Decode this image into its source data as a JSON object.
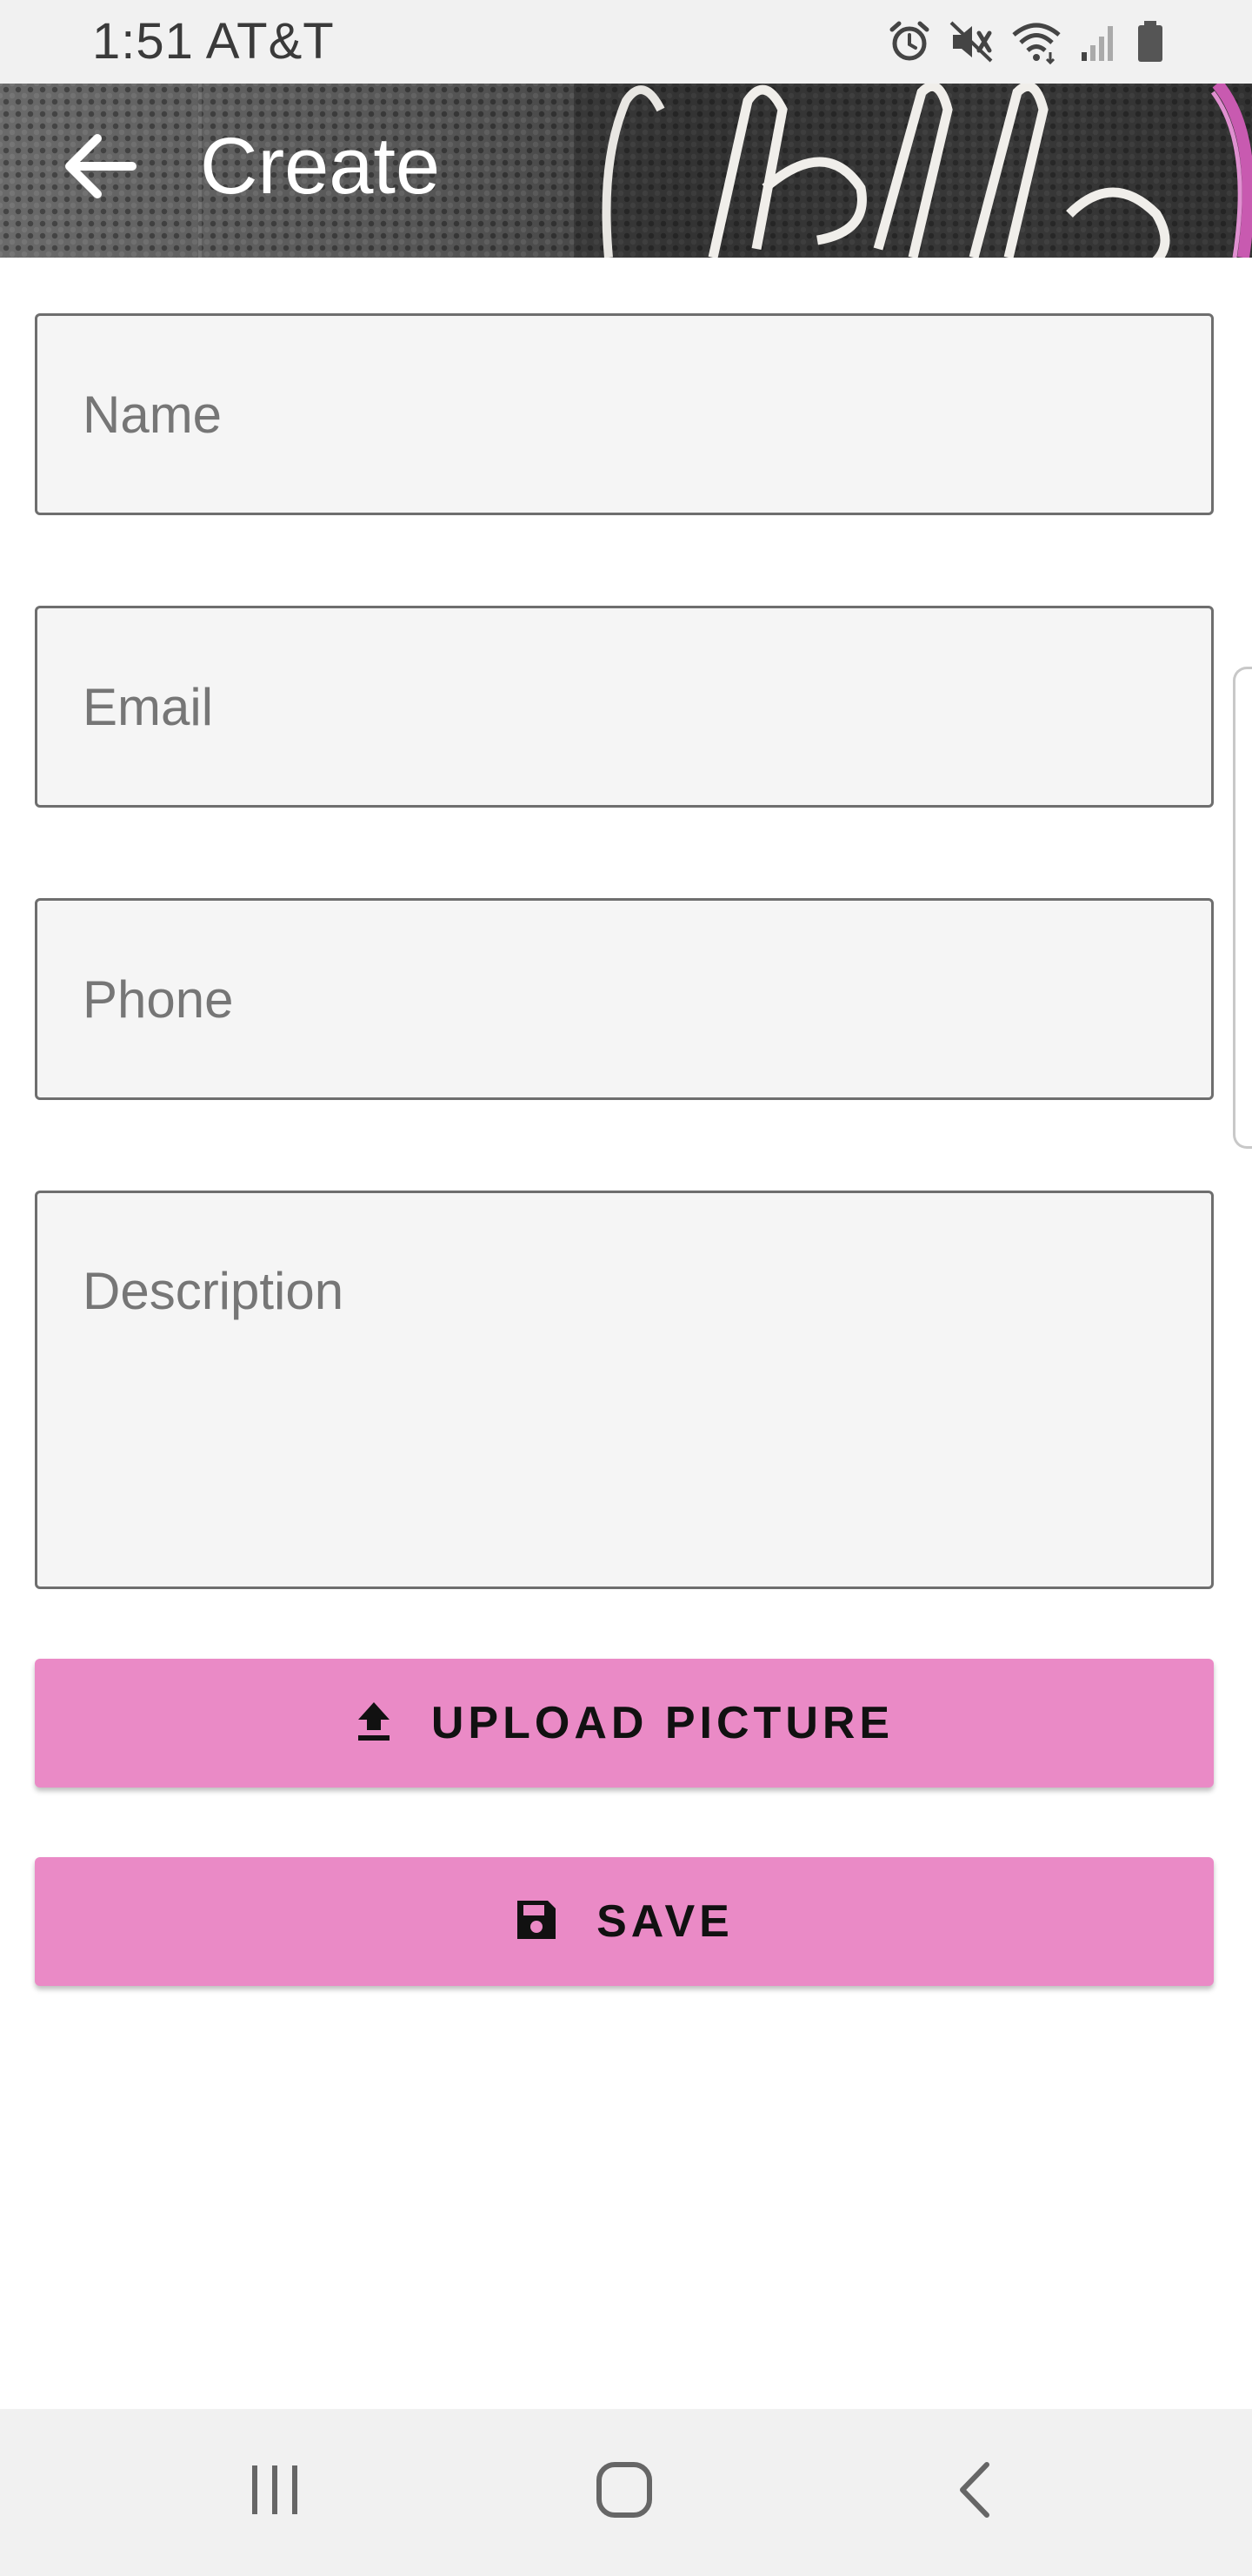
{
  "status_bar": {
    "time_carrier": "1:51 AT&T",
    "icons": [
      "alarm-icon",
      "vibrate-mute-icon",
      "wifi-icon",
      "signal-icon",
      "battery-icon"
    ]
  },
  "header": {
    "title": "Create",
    "back_icon": "arrow-left-icon"
  },
  "form": {
    "name_placeholder": "Name",
    "email_placeholder": "Email",
    "phone_placeholder": "Phone",
    "description_placeholder": "Description"
  },
  "buttons": {
    "upload_label": "UPLOAD PICTURE",
    "upload_icon": "upload-icon",
    "save_label": "SAVE",
    "save_icon": "floppy-disk-icon"
  },
  "nav_bar": {
    "items": [
      "recents-icon",
      "home-icon",
      "back-icon"
    ]
  },
  "colors": {
    "accent": "#ea8ac6",
    "field_bg": "#f5f5f5",
    "field_border": "#6e6e6e",
    "status_bar_bg": "#f1f1f1"
  }
}
